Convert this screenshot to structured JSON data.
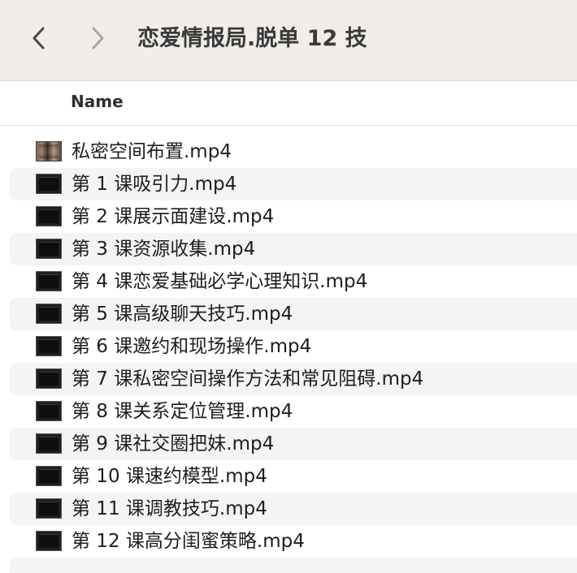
{
  "window": {
    "title": "恋爱情报局.脱单 12 技"
  },
  "navigation": {
    "back_icon": "chevron-left-icon",
    "forward_icon": "chevron-right-icon"
  },
  "columns": {
    "name_label": "Name"
  },
  "files": [
    {
      "name": "私密空间布置.mp4",
      "thumbnail": "video-preview"
    },
    {
      "name": "第 1 课吸引力.mp4",
      "thumbnail": "video-black"
    },
    {
      "name": "第 2 课展示面建设.mp4",
      "thumbnail": "video-black"
    },
    {
      "name": "第 3 课资源收集.mp4",
      "thumbnail": "video-black"
    },
    {
      "name": "第 4 课恋爱基础必学心理知识.mp4",
      "thumbnail": "video-black"
    },
    {
      "name": "第 5 课高级聊天技巧.mp4",
      "thumbnail": "video-black"
    },
    {
      "name": "第 6 课邀约和现场操作.mp4",
      "thumbnail": "video-black"
    },
    {
      "name": "第 7 课私密空间操作方法和常见阻碍.mp4",
      "thumbnail": "video-black"
    },
    {
      "name": "第 8 课关系定位管理.mp4",
      "thumbnail": "video-black"
    },
    {
      "name": "第 9 课社交圈把妹.mp4",
      "thumbnail": "video-black"
    },
    {
      "name": "第 10 课速约模型.mp4",
      "thumbnail": "video-black"
    },
    {
      "name": "第 11 课调教技巧.mp4",
      "thumbnail": "video-black"
    },
    {
      "name": "第 12 课高分闺蜜策略.mp4",
      "thumbnail": "video-black"
    }
  ],
  "colors": {
    "toolbar_bg": "#f1ede9",
    "row_stripe": "#f4f4f4",
    "text": "#1e1e1e"
  }
}
